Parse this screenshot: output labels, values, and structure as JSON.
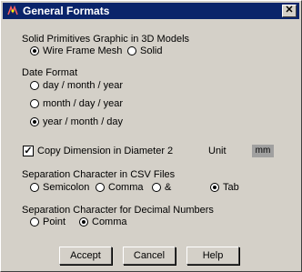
{
  "window": {
    "title": "General Formats",
    "close_glyph": "✕"
  },
  "solid": {
    "label": "Solid Primitives Graphic in 3D Models",
    "options": [
      {
        "label": "Wire Frame Mesh",
        "selected": true
      },
      {
        "label": "Solid",
        "selected": false
      }
    ]
  },
  "date": {
    "label": "Date Format",
    "options": [
      {
        "label": "day / month / year",
        "selected": false
      },
      {
        "label": "month / day / year",
        "selected": false
      },
      {
        "label": "year / month / day",
        "selected": true
      }
    ]
  },
  "diameter": {
    "label": "Copy Dimension in Diameter 2",
    "checked": true,
    "check_glyph": "✓",
    "unit_label": "Unit",
    "unit_value": "mm"
  },
  "csv": {
    "label": "Separation Character in CSV Files",
    "options": [
      {
        "label": "Semicolon",
        "selected": false
      },
      {
        "label": "Comma",
        "selected": false
      },
      {
        "label": "&",
        "selected": false
      },
      {
        "label": "Tab",
        "selected": true
      }
    ]
  },
  "decimal": {
    "label": "Separation Character for Decimal Numbers",
    "options": [
      {
        "label": "Point",
        "selected": false
      },
      {
        "label": "Comma",
        "selected": true
      }
    ]
  },
  "buttons": {
    "accept": "Accept",
    "cancel": "Cancel",
    "help": "Help"
  }
}
